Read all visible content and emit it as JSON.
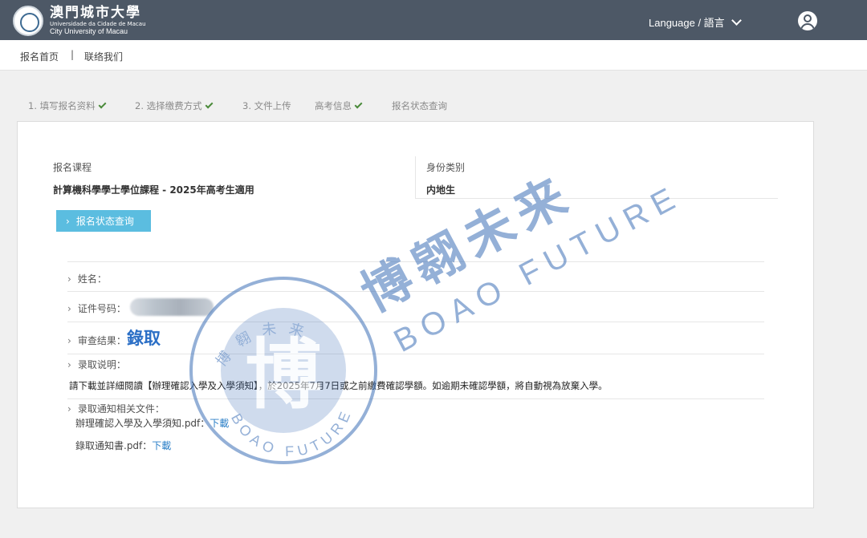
{
  "header": {
    "logo": {
      "name_cn": "澳門城市大學",
      "name_pt": "Universidade da Cidade de Macau",
      "name_en": "City University of Macau"
    },
    "language_label": "Language / 語言"
  },
  "subnav": {
    "home": "报名首页",
    "separator": "|",
    "contact": "联络我们"
  },
  "steps": [
    {
      "label": "1. 填写报名资料",
      "done": true
    },
    {
      "label": "2. 选择缴费方式",
      "done": true
    },
    {
      "label": "3. 文件上传",
      "done": false
    },
    {
      "label": "高考信息",
      "done": true
    },
    {
      "label": "报名状态查询",
      "done": false
    }
  ],
  "application": {
    "course_label": "报名课程",
    "course_value": "計算機科學學士學位課程 - 2025年高考生適用",
    "identity_label": "身份类别",
    "identity_value": "内地生"
  },
  "status_button": "报名状态查询",
  "details": {
    "name_label": "姓名：",
    "id_label": "证件号码：",
    "review_label": "审查结果：",
    "review_value": "錄取",
    "admission_label": "录取说明：",
    "admission_notice": "請下載並詳細閱讀【辦理確認入學及入學須知】，於2025年7月7日或之前繳費確認學額。如逾期未確認學額，將自動視為放棄入學。",
    "files_label": "录取通知相关文件：",
    "files": [
      {
        "name": "辦理確認入學及入學須知.pdf：",
        "link": "下載"
      },
      {
        "name": "錄取通知書.pdf：",
        "link": "下載"
      }
    ]
  },
  "watermark": {
    "cn": "博翱未来",
    "en": "BOAO FUTURE",
    "seal_cn": "博翱未来",
    "seal_en": "BOAO FUTURE"
  },
  "colors": {
    "topbar": "#4d5866",
    "button": "#5bbde0",
    "result": "#2b6fc6",
    "link": "#2b7fc7",
    "check": "#4a8a3a",
    "watermark": "#3d6fb6"
  }
}
